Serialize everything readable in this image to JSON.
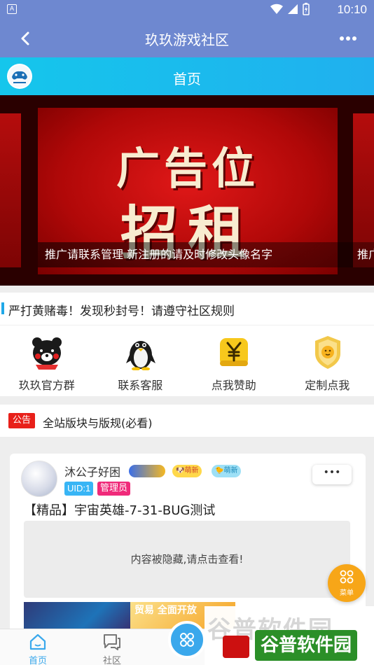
{
  "status_bar": {
    "time": "10:10",
    "notification_glyph": "A"
  },
  "title_bar": {
    "title": "玖玖游戏社区"
  },
  "home_header": {
    "title": "首页"
  },
  "banner": {
    "slogan_line1": "广告位",
    "slogan_line2": "招租",
    "caption": "推广请联系管理 新注册的请及时修改头像名字",
    "caption_next": "推广"
  },
  "notice": {
    "text": "严打黄赌毒！发现秒封号！请遵守社区规则"
  },
  "quick_links": [
    {
      "label": "玖玖官方群",
      "icon": "bear-icon"
    },
    {
      "label": "联系客服",
      "icon": "penguin-icon"
    },
    {
      "label": "点我赞助",
      "icon": "yuan-coin-icon"
    },
    {
      "label": "定制点我",
      "icon": "gold-badge-icon"
    }
  ],
  "announcement": {
    "badge": "公告",
    "text": "全站版块与版规(必看)"
  },
  "post": {
    "username": "沐公子好困",
    "uid": "UID:1",
    "role": "管理员",
    "medal_new": "萌新",
    "medal_new2": "萌新",
    "more": "•••",
    "title": "【精品】宇宙英雄-7-31-BUG测试",
    "hidden_notice": "内容被隐藏,请点击查看!",
    "thumb2_text": "贸易 全面开放"
  },
  "fab": {
    "label": "菜单"
  },
  "tabbar": {
    "home": "首页",
    "community": "社区"
  },
  "watermark": {
    "bg_text": "谷普软件园",
    "fg_text": "谷普软件园"
  },
  "colors": {
    "primary": "#6e88d0",
    "header_blue": "#1fb8ee",
    "badge_red": "#e8201a",
    "fab_orange": "#f7a618"
  }
}
